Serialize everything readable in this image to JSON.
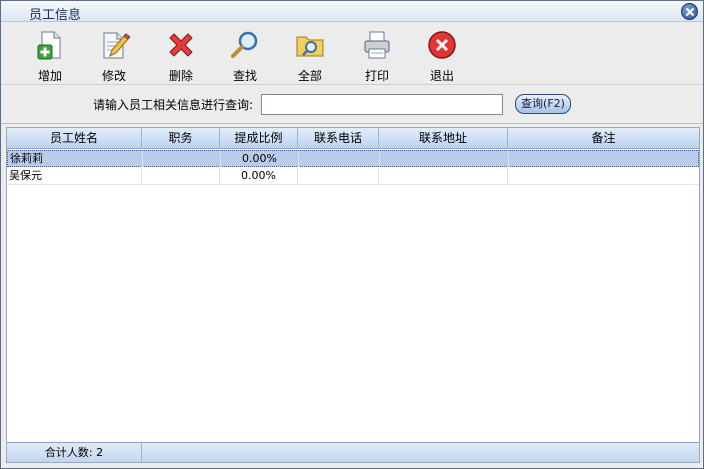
{
  "window": {
    "title": "员工信息"
  },
  "toolbar": {
    "buttons": [
      {
        "label": "增加",
        "icon": "add-document-icon"
      },
      {
        "label": "修改",
        "icon": "edit-document-icon"
      },
      {
        "label": "删除",
        "icon": "delete-x-icon"
      },
      {
        "label": "查找",
        "icon": "magnifier-icon"
      },
      {
        "label": "全部",
        "icon": "folder-search-icon"
      },
      {
        "label": "打印",
        "icon": "printer-icon"
      },
      {
        "label": "退出",
        "icon": "exit-icon"
      }
    ]
  },
  "search": {
    "prompt": "请输入员工相关信息进行查询:",
    "value": "",
    "placeholder": "",
    "button_label": "查询(F2)"
  },
  "table": {
    "columns": [
      "员工姓名",
      "职务",
      "提成比例",
      "联系电话",
      "联系地址",
      "备注"
    ],
    "rows": [
      {
        "name": "徐莉莉",
        "title": "",
        "rate": "0.00%",
        "phone": "",
        "address": "",
        "note": "",
        "selected": true
      },
      {
        "name": "吴保元",
        "title": "",
        "rate": "0.00%",
        "phone": "",
        "address": "",
        "note": "",
        "selected": false
      }
    ],
    "footer": "合计人数: 2"
  },
  "colors": {
    "accent": "#2c4f8c",
    "header": "#bcd2ef",
    "selected_row": "#b9cdea"
  }
}
